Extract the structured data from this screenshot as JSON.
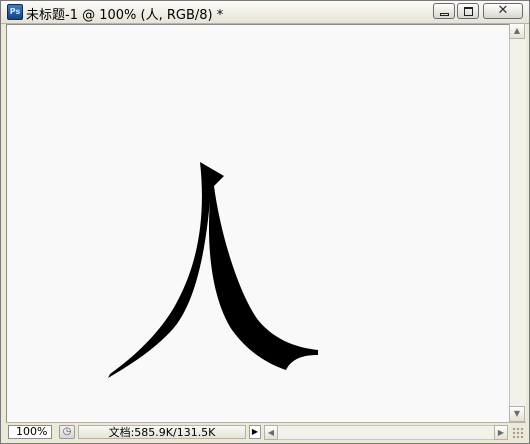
{
  "window": {
    "app_icon_label": "Ps",
    "title": "未标题-1 @ 100% (人, RGB/8) *",
    "buttons": {
      "minimize": "minimize-icon",
      "maximize": "maximize-icon",
      "close": "close-icon",
      "close_glyph": "✕"
    }
  },
  "canvas": {
    "background": "#f9f9f9",
    "glyph_color": "#000000",
    "layer_text": "人"
  },
  "scrollbars": {
    "up_arrow": "▲",
    "down_arrow": "▼",
    "left_arrow": "◀",
    "right_arrow": "▶"
  },
  "statusbar": {
    "zoom": "100%",
    "doc_info": "文档:585.9K/131.5K",
    "menu_arrow": "▶"
  }
}
